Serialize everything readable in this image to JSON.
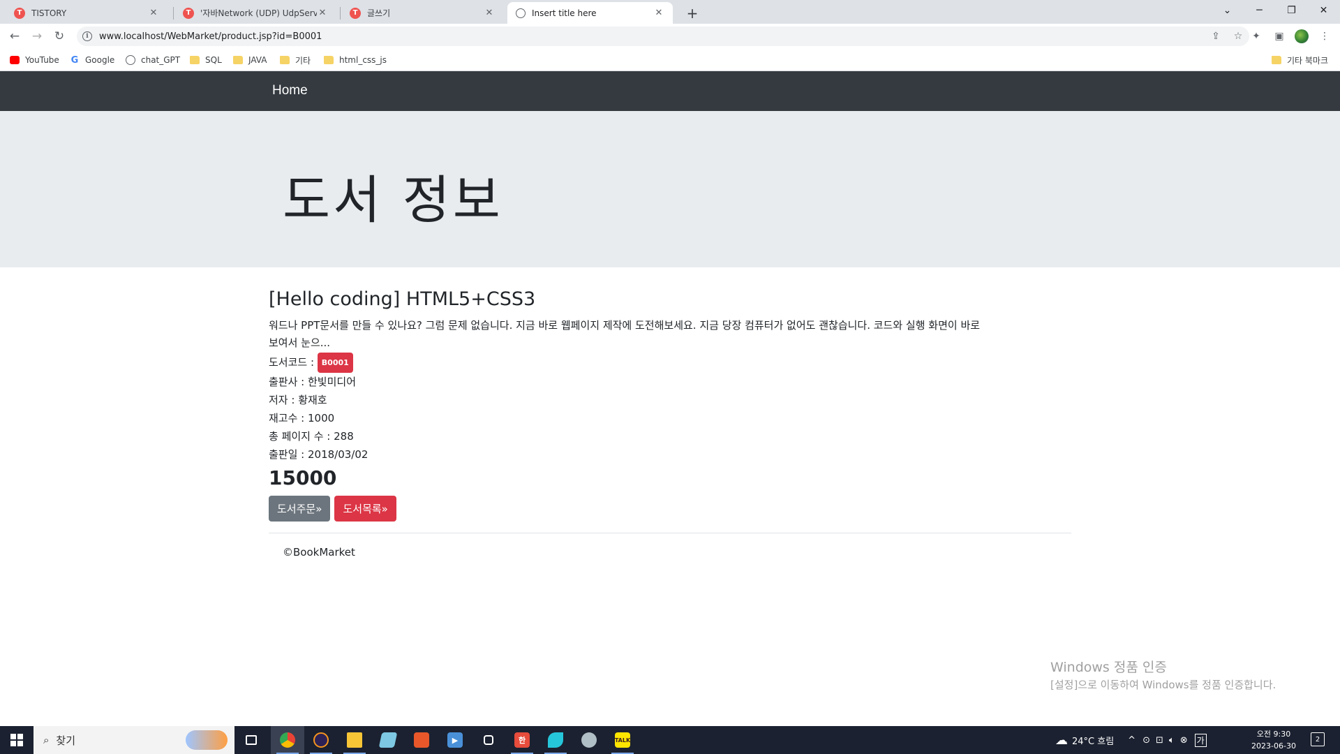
{
  "browser": {
    "tabs": [
      {
        "title": "TISTORY",
        "favicon": "tistory-icon",
        "active": false
      },
      {
        "title": "'자바Network (UDP) UdpServer'",
        "favicon": "tistory-icon",
        "active": false
      },
      {
        "title": "글쓰기",
        "favicon": "tistory-icon",
        "active": false
      },
      {
        "title": "Insert title here",
        "favicon": "globe-icon",
        "active": true
      }
    ],
    "new_tab": "+",
    "url": "www.localhost/WebMarket/product.jsp?id=B0001",
    "bookmarks": [
      {
        "label": "YouTube",
        "icon": "youtube-icon"
      },
      {
        "label": "Google",
        "icon": "google-icon"
      },
      {
        "label": "chat_GPT",
        "icon": "chatgpt-icon"
      },
      {
        "label": "SQL",
        "icon": "folder-icon"
      },
      {
        "label": "JAVA",
        "icon": "folder-icon"
      },
      {
        "label": "기타",
        "icon": "folder-icon"
      },
      {
        "label": "html_css_js",
        "icon": "folder-icon"
      }
    ],
    "other_bookmarks": "기타 북마크"
  },
  "page": {
    "nav_brand": "Home",
    "jumbotron_title": "도서 정보",
    "product": {
      "name": "[Hello coding] HTML5+CSS3",
      "description_1": "워드나 PPT문서를 만들 수 있나요? 그럼 문제 없습니다. 지금 바로 웹페이지 제작에 도전해보세요. 지금 당장 컴퓨터가 없어도 괜찮습니다. 코드와 실행 화면이 바로",
      "description_2": "보여서 눈으...",
      "code_label": "도서코드 : ",
      "code": "B0001",
      "publisher": "출판사 : 한빛미디어",
      "author": "저자 : 황재호",
      "stock": "재고수 : 1000",
      "pages": "총 페이지 수 : 288",
      "release_date": "출판일 : 2018/03/02",
      "price": "15000",
      "order_button": "도서주문»",
      "list_button": "도서목록»"
    },
    "footer": "©BookMarket"
  },
  "watermark": {
    "line1": "Windows 정품 인증",
    "line2": "[설정]으로 이동하여 Windows를 정품 인증합니다."
  },
  "taskbar": {
    "search_placeholder": "찾기",
    "weather": "24°C  흐림",
    "time": "오전 9:30",
    "date": "2023-06-30",
    "notification_count": "2",
    "ime": "가"
  },
  "colors": {
    "navbar": "#343a40",
    "jumbotron": "#e9ecef",
    "badge": "#dc3545",
    "btn_secondary": "#6c757d",
    "btn_danger": "#dc3545",
    "taskbar": "#1b2130"
  }
}
